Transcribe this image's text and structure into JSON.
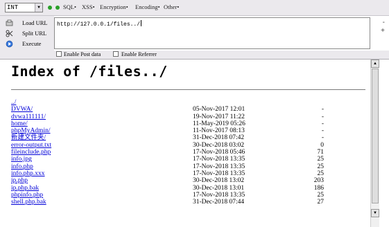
{
  "toolbar": {
    "select_value": "INT",
    "menus": [
      "SQL•",
      "XSS•",
      "Encryption•",
      "Encoding•",
      "Other•"
    ]
  },
  "left_panel": {
    "load_url": "Load URL",
    "split_url": "Split URL",
    "execute": "Execute"
  },
  "url_field": {
    "value": "http://127.0.0.1/files../"
  },
  "side_buttons": {
    "minus": "-",
    "plus": "+"
  },
  "options": {
    "post_data": "Enable Post data",
    "referrer": "Enable Referrer"
  },
  "page": {
    "title": "Index of /files../"
  },
  "listing": [
    {
      "name": "../",
      "date": "",
      "size": ""
    },
    {
      "name": "DVWA/",
      "date": "05-Nov-2017 12:01",
      "size": "-"
    },
    {
      "name": "dvwa111111/",
      "date": "19-Nov-2017 11:22",
      "size": "-"
    },
    {
      "name": "home/",
      "date": "11-May-2019 05:26",
      "size": "-"
    },
    {
      "name": "phpMyAdmin/",
      "date": "11-Nov-2017 08:13",
      "size": "-"
    },
    {
      "name": "新建文件夹/",
      "date": "31-Dec-2018 07:42",
      "size": "-"
    },
    {
      "name": "error-output.txt",
      "date": "30-Dec-2018 03:02",
      "size": "0"
    },
    {
      "name": "fileinclude.php",
      "date": "17-Nov-2018 05:46",
      "size": "71"
    },
    {
      "name": "info.jpg",
      "date": "17-Nov-2018 13:35",
      "size": "25"
    },
    {
      "name": "info.php",
      "date": "17-Nov-2018 13:35",
      "size": "25"
    },
    {
      "name": "info.php.xxx",
      "date": "17-Nov-2018 13:35",
      "size": "25"
    },
    {
      "name": "ip.php",
      "date": "30-Dec-2018 13:02",
      "size": "203"
    },
    {
      "name": "ip.php.bak",
      "date": "30-Dec-2018 13:01",
      "size": "186"
    },
    {
      "name": "phpinfo.php",
      "date": "17-Nov-2018 13:35",
      "size": "25"
    },
    {
      "name": "shell.php.bak",
      "date": "31-Dec-2018 07:44",
      "size": "27"
    }
  ],
  "colors": {
    "link": "#0000d8",
    "toolbar_bg": "#ebe9ed",
    "indicator": "#2aa02a"
  }
}
